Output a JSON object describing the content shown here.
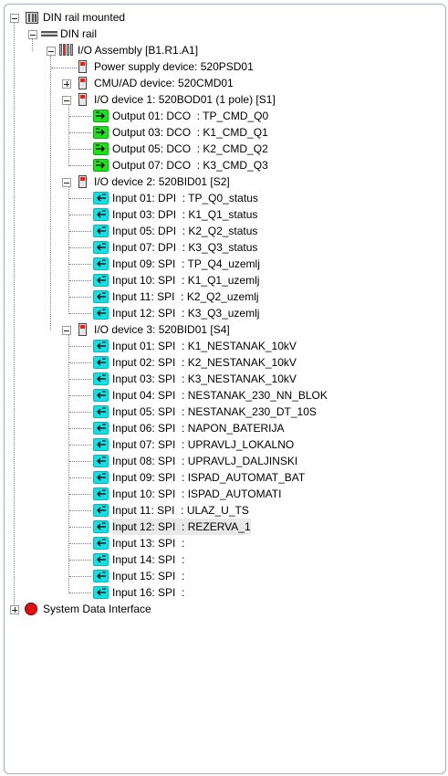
{
  "tree": {
    "root": {
      "label": "DIN rail mounted"
    },
    "rail": {
      "label": "DIN rail"
    },
    "assembly": {
      "label": "I/O Assembly [B1.R1.A1]"
    },
    "psu": {
      "label": "Power supply device: 520PSD01"
    },
    "cmu": {
      "label": "CMU/AD device: 520CMD01"
    },
    "io1": {
      "label": "I/O device 1: 520BOD01 (1 pole) [S1]",
      "items": [
        {
          "label": "Output 01: DCO  : TP_CMD_Q0"
        },
        {
          "label": "Output 03: DCO  : K1_CMD_Q1"
        },
        {
          "label": "Output 05: DCO  : K2_CMD_Q2"
        },
        {
          "label": "Output 07: DCO  : K3_CMD_Q3"
        }
      ]
    },
    "io2": {
      "label": "I/O device 2: 520BID01 [S2]",
      "items": [
        {
          "label": "Input 01: DPI  : TP_Q0_status"
        },
        {
          "label": "Input 03: DPI  : K1_Q1_status"
        },
        {
          "label": "Input 05: DPI  : K2_Q2_status"
        },
        {
          "label": "Input 07: DPI  : K3_Q3_status"
        },
        {
          "label": "Input 09: SPI  : TP_Q4_uzemlj"
        },
        {
          "label": "Input 10: SPI  : K1_Q1_uzemlj"
        },
        {
          "label": "Input 11: SPI  : K2_Q2_uzemlj"
        },
        {
          "label": "Input 12: SPI  : K3_Q3_uzemlj"
        }
      ]
    },
    "io3": {
      "label": "I/O device 3: 520BID01 [S4]",
      "items": [
        {
          "label": "Input 01: SPI  : K1_NESTANAK_10kV"
        },
        {
          "label": "Input 02: SPI  : K2_NESTANAK_10kV"
        },
        {
          "label": "Input 03: SPI  : K3_NESTANAK_10kV"
        },
        {
          "label": "Input 04: SPI  : NESTANAK_230_NN_BLOK"
        },
        {
          "label": "Input 05: SPI  : NESTANAK_230_DT_10S"
        },
        {
          "label": "Input 06: SPI  : NAPON_BATERIJA"
        },
        {
          "label": "Input 07: SPI  : UPRAVLJ_LOKALNO"
        },
        {
          "label": "Input 08: SPI  : UPRAVLJ_DALJINSKI"
        },
        {
          "label": "Input 09: SPI  : ISPAD_AUTOMAT_BAT"
        },
        {
          "label": "Input 10: SPI  : ISPAD_AUTOMATI"
        },
        {
          "label": "Input 11: SPI  : ULAZ_U_TS"
        },
        {
          "label": "Input 12: SPI  : REZERVA_1"
        },
        {
          "label": "Input 13: SPI  :"
        },
        {
          "label": "Input 14: SPI  :"
        },
        {
          "label": "Input 15: SPI  :"
        },
        {
          "label": "Input 16: SPI  :"
        }
      ]
    },
    "sdi": {
      "label": "System Data Interface"
    }
  },
  "selected_item": "io3.items.11",
  "colors": {
    "output_icon": "#22dd22",
    "input_icon": "#19dde0",
    "sdi_icon": "#e01010",
    "selection": "#e9e9e9"
  },
  "icons": {
    "output": "arrow-right-icon",
    "input": "arrow-left-icon",
    "device": "device-module-icon",
    "sdi": "red-circle-icon"
  }
}
